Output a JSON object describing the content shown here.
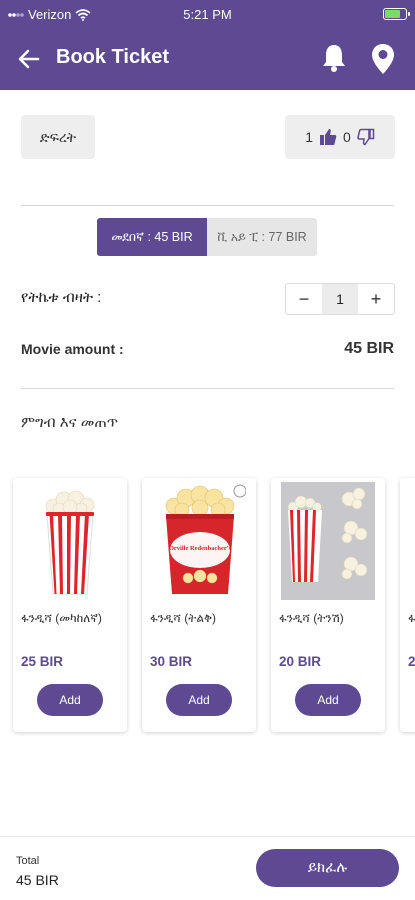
{
  "status_bar": {
    "carrier": "Verizon",
    "time": "5:21 PM"
  },
  "app_bar": {
    "title": "Book Ticket"
  },
  "movie": {
    "genre": "ድፍረት",
    "likes": "1",
    "dislikes": "0"
  },
  "seat_types": [
    {
      "label": "መደበኛ : 45 BIR",
      "selected": true
    },
    {
      "label": "ቪ አይ ፒ : 77 BIR",
      "selected": false
    }
  ],
  "ticket": {
    "quantity_label": "የትኬቱ ብዛት :",
    "quantity": "1",
    "decrement": "−",
    "increment": "+",
    "amount_label": "Movie amount :",
    "amount_value": "45 BIR"
  },
  "food_section": {
    "title": "ምግብ እና መጠጥ"
  },
  "products": [
    {
      "name": "ፋንዲሻ (መካከለኛ)",
      "price": "25 BIR",
      "add_label": "Add"
    },
    {
      "name": "ፋንዲሻ (ትልቅ)",
      "price": "30 BIR",
      "add_label": "Add",
      "brand": "Orville Redenbacher's"
    },
    {
      "name": "ፋንዲሻ (ትንሽ)",
      "price": "20 BIR",
      "add_label": "Add"
    },
    {
      "name": "ፋ",
      "price": "2"
    }
  ],
  "footer": {
    "total_label": "Total",
    "total_value": "45 BIR",
    "pay_label": "ይክፈሉ"
  },
  "colors": {
    "primary": "#5d4a93",
    "chip": "#eeeeee",
    "battery": "#7dd96a"
  }
}
